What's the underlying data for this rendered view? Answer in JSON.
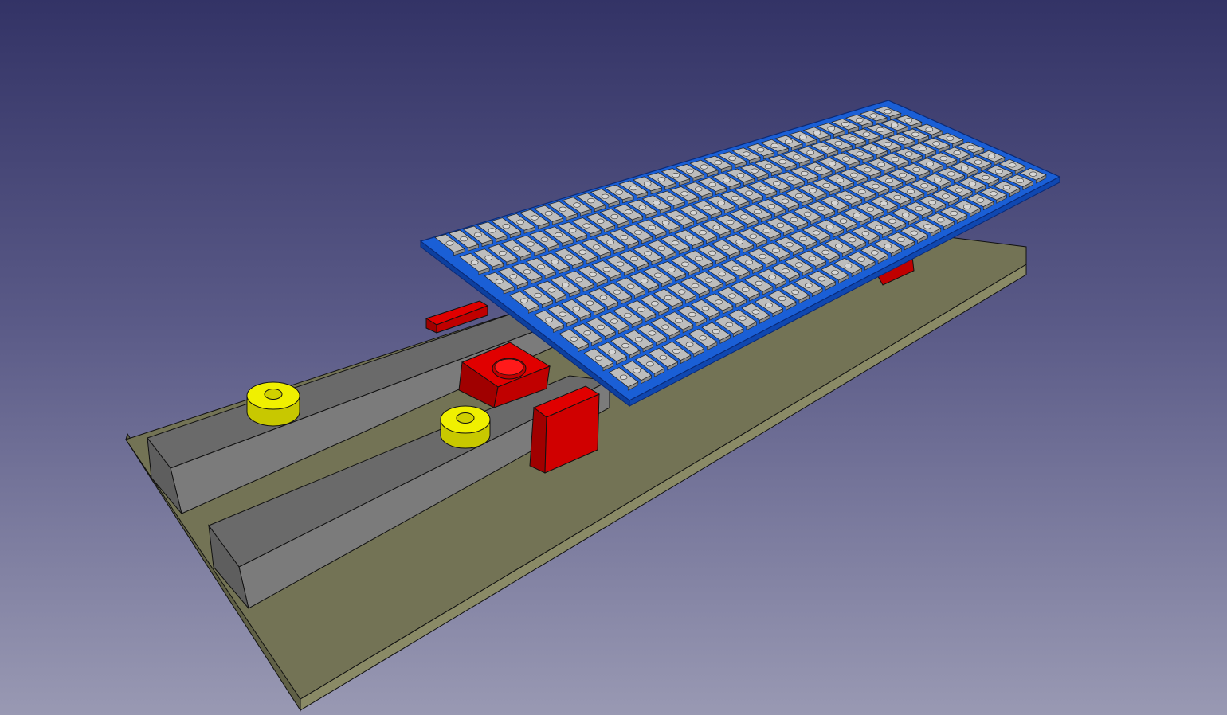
{
  "view": {
    "background_top": "#333366",
    "background_bottom": "#9999b3",
    "projection": "perspective"
  },
  "colors": {
    "base_top": "#7a7a58",
    "base_side": "#6e6e50",
    "base_front": "#8a8a66",
    "rail_top": "#6b6b6b",
    "rail_side": "#7d7d7d",
    "clamp_red": "#e00000",
    "clamp_red_dark": "#a00000",
    "washer_yellow": "#f0f000",
    "washer_yellow_dark": "#c8c800",
    "pcb_blue": "#1a5fd6",
    "pcb_blue_dark": "#0d3f9e",
    "led_gray": "#bdbdbd",
    "led_gray_dark": "#8c8c8c",
    "edge": "#111111"
  },
  "model": {
    "led_matrix": {
      "rows": 8,
      "cols": 32
    },
    "washers": 2,
    "rails": 2,
    "red_clamps": 4
  }
}
